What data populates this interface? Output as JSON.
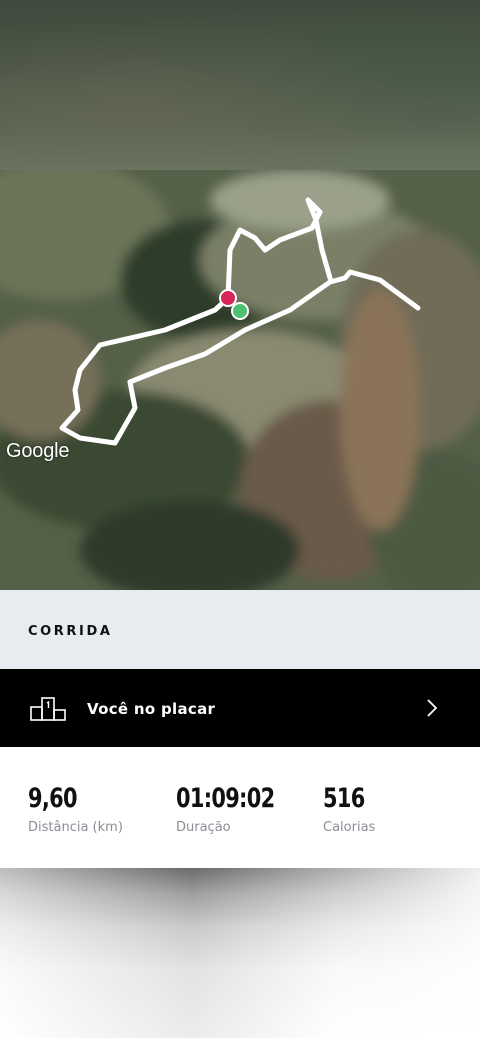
{
  "map": {
    "attribution": "Google",
    "route_color": "#ffffff",
    "start_marker_color": "#4fbf72",
    "end_marker_color": "#d6255a"
  },
  "activity": {
    "type_label": "CORRIDA"
  },
  "scoreboard": {
    "label": "Você no placar",
    "icon": "podium-icon",
    "chevron": "chevron-right-icon"
  },
  "stats": [
    {
      "value": "9,60",
      "label": "Distância (km)"
    },
    {
      "value": "01:09:02",
      "label": "Duração"
    },
    {
      "value": "516",
      "label": "Calorias"
    }
  ]
}
